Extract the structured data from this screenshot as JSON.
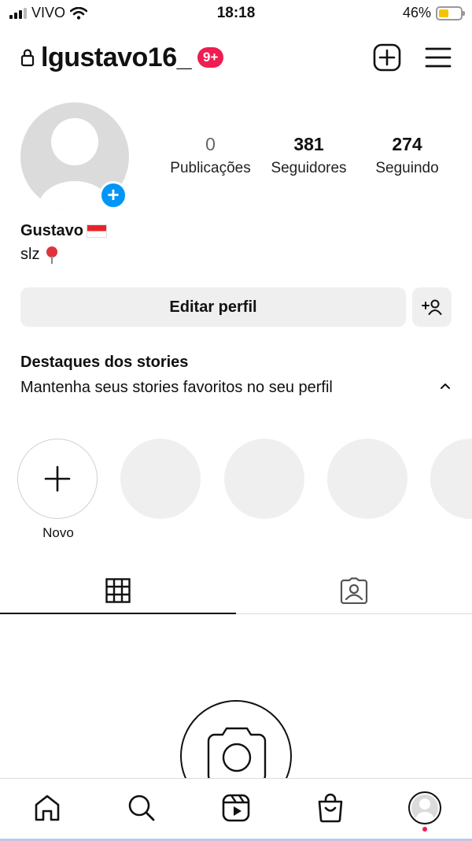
{
  "status_bar": {
    "carrier": "VIVO",
    "time": "18:18",
    "battery_percent_text": "46%",
    "battery_level": 0.46,
    "battery_color": "#f5c400"
  },
  "header": {
    "username": "lgustavo16_",
    "notification_badge": "9+",
    "badge_color": "#ee1d52",
    "icons": [
      "lock-icon",
      "new-post-icon",
      "menu-icon"
    ]
  },
  "profile": {
    "stats": [
      {
        "value": "0",
        "label": "Publicações"
      },
      {
        "value": "381",
        "label": "Seguidores"
      },
      {
        "value": "274",
        "label": "Seguindo"
      }
    ],
    "name": "Gustavo",
    "bio": "slz",
    "accent_color": "#0095f6"
  },
  "actions": {
    "edit_profile_label": "Editar perfil"
  },
  "highlights": {
    "title": "Destaques dos stories",
    "subtitle": "Mantenha seus stories favoritos no seu perfil",
    "new_label": "Novo"
  },
  "tabs": [
    "grid-icon",
    "tagged-icon"
  ],
  "bottom_nav": [
    "home-icon",
    "search-icon",
    "reels-icon",
    "shop-icon",
    "profile-avatar"
  ]
}
